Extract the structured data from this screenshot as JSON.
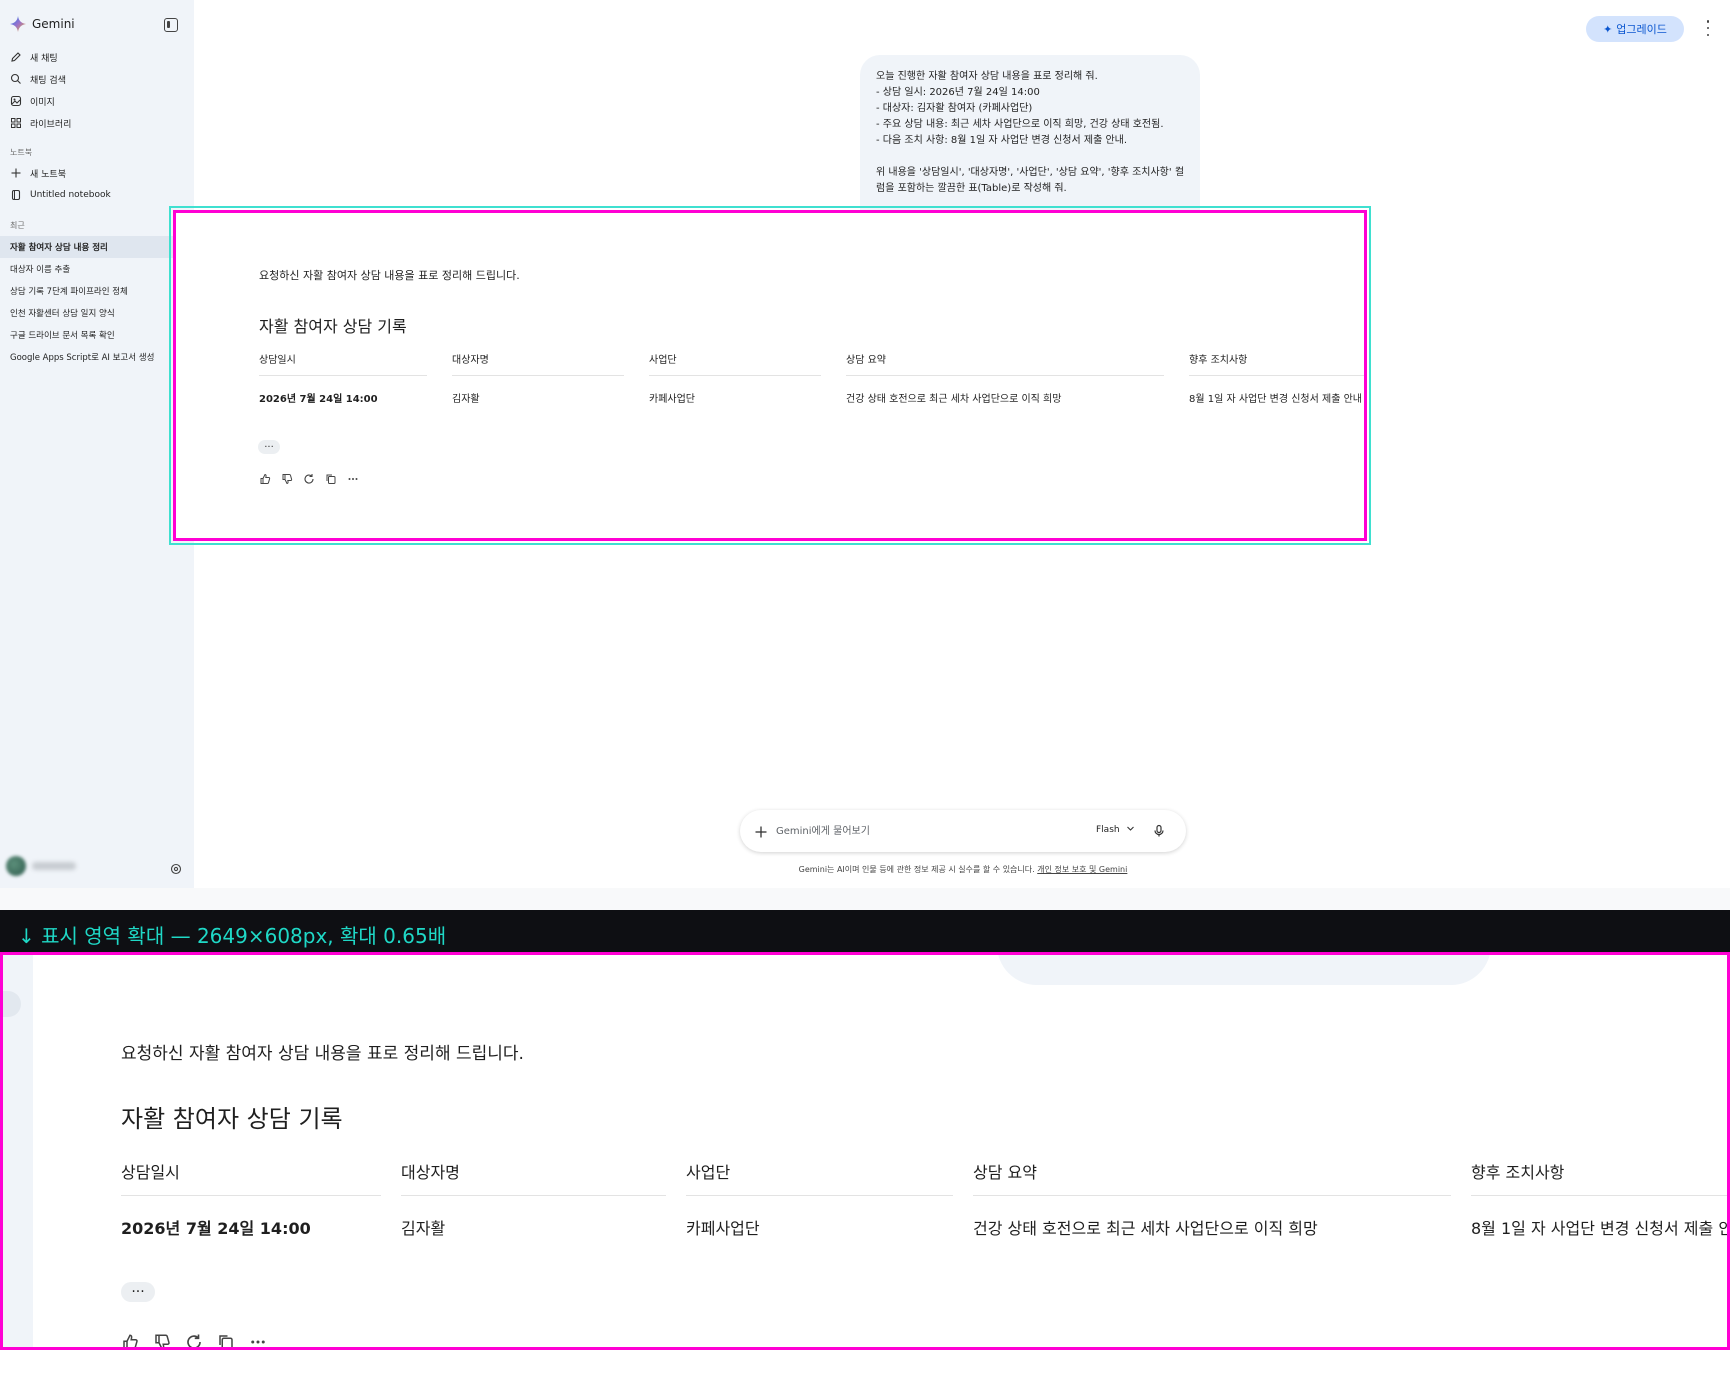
{
  "app": {
    "brand": "Gemini",
    "upgrade_label": "업그레이드"
  },
  "sidebar": {
    "nav": [
      {
        "label": "새 채팅",
        "icon": "edit-icon"
      },
      {
        "label": "채팅 검색",
        "icon": "search-icon"
      },
      {
        "label": "이미지",
        "icon": "image-icon"
      },
      {
        "label": "라이브러리",
        "icon": "library-icon"
      }
    ],
    "notebook_section": "노트북",
    "notebook_items": [
      {
        "label": "새 노트북",
        "icon": "plus-icon"
      },
      {
        "label": "Untitled notebook",
        "icon": "notebook-icon"
      }
    ],
    "recent_section": "최근",
    "recent_items": [
      "자활 참여자 상담 내용 정리",
      "대상자 이름 추출",
      "상담 기록 7단계 파이프라인 정체",
      "인천 자활센터 상담 일지 양식",
      "구글 드라이브 문서 목록 확인",
      "Google Apps Script로 AI 보고서 생성"
    ]
  },
  "user_message": "오늘 진행한 자활 참여자 상담 내용을 표로 정리해 줘.\n- 상담 일시: 2026년 7월 24일 14:00\n- 대상자: 김자활 참여자 (카페사업단)\n- 주요 상담 내용: 최근 세차 사업단으로 이직 희망, 건강 상태 호전됨.\n- 다음 조치 사항: 8월 1일 자 사업단 변경 신청서 제출 안내.\n\n위 내용을 '상담일시', '대상자명', '사업단', '상담 요약', '향후 조치사항' 컬럼을 포함하는 깔끔한 표(Table)로 작성해 줘.",
  "response": {
    "intro": "요청하신 자활 참여자 상담 내용을 표로 정리해 드립니다.",
    "heading": "자활 참여자 상담 기록",
    "table": {
      "headers": [
        "상담일시",
        "대상자명",
        "사업단",
        "상담 요약",
        "향후 조치사항"
      ],
      "rows": [
        [
          "2026년 7월 24일 14:00",
          "김자활",
          "카페사업단",
          "건강 상태 호전으로 최근 세차 사업단으로 이직 희망",
          "8월 1일 자 사업단 변경 신청서 제출 안내"
        ]
      ]
    },
    "more_chip": "···"
  },
  "input": {
    "placeholder": "Gemini에게 물어보기",
    "model": "Flash"
  },
  "disclaimer": {
    "text": "Gemini는 AI이며 인물 등에 관한 정보 제공 시 실수를 할 수 있습니다. ",
    "link": "개인 정보 보호 및 Gemini"
  },
  "zoom_banner": "↓ 표시 영역 확대 — 2649×608px, 확대 0.65배",
  "colors": {
    "accent": "#0b57d0",
    "zoom_outline": "#ff00d4",
    "crop_outline": "#3fe0d0",
    "banner_text": "#1fd8c6"
  }
}
